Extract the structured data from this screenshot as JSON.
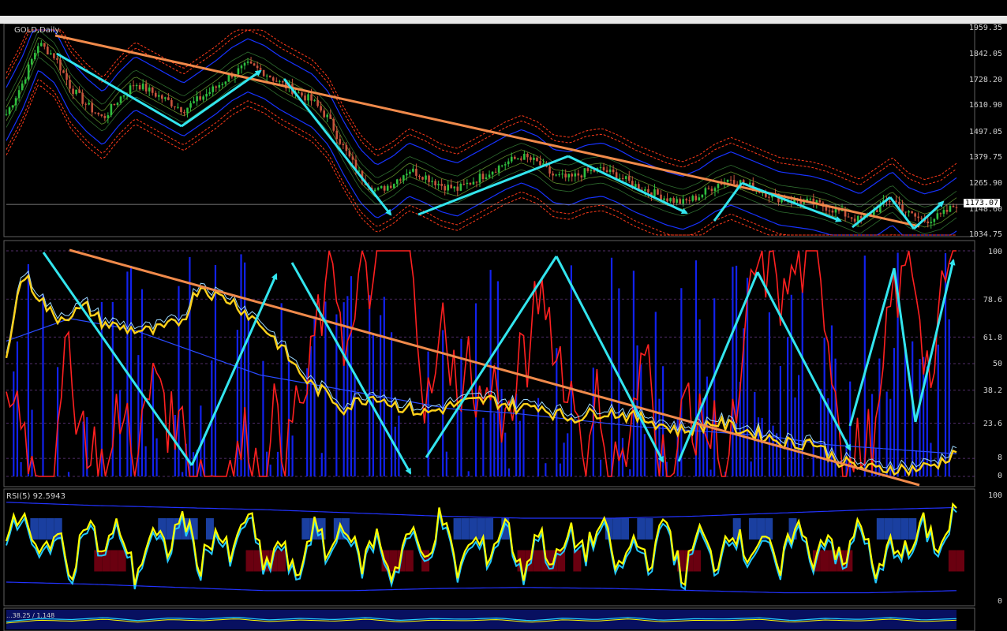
{
  "window": {
    "title": "GOLD,Daily"
  },
  "colors": {
    "background": "#000000",
    "trend_line": "#f08a4b",
    "wave_arrows": "#33e5ee",
    "price_up": "#2fbf3f",
    "price_down": "#c8553d",
    "band_blue": "#1733ff",
    "band_red": "#ff3a1a",
    "oscillator_yellow": "#ffd21a",
    "stoch_red": "#ff2020",
    "stoch_blue": "#1222ee",
    "rsi_yellow": "#ffff00",
    "rsi_cyan": "#22c8ff"
  },
  "chart_data": [
    {
      "type": "line",
      "pane": "price",
      "title": "GOLD,Daily",
      "ylim": [
        1034.75,
        1959.35
      ],
      "y_ticks": [
        "1959.35",
        "1842.05",
        "1728.20",
        "1610.90",
        "1497.05",
        "1379.75",
        "1265.90",
        "1148.60",
        "1034.75"
      ],
      "current_price": "1173.07",
      "series": [
        {
          "values": [
            1580,
            1720,
            1900,
            1840,
            1700,
            1620,
            1560,
            1650,
            1720,
            1680,
            1640,
            1600,
            1650,
            1700,
            1760,
            1800,
            1770,
            1720,
            1680,
            1640,
            1560,
            1420,
            1300,
            1230,
            1270,
            1330,
            1300,
            1260,
            1240,
            1280,
            1320,
            1360,
            1390,
            1360,
            1300,
            1290,
            1320,
            1330,
            1300,
            1260,
            1230,
            1200,
            1180,
            1210,
            1260,
            1290,
            1260,
            1230,
            1200,
            1190,
            1180,
            1160,
            1130,
            1100,
            1150,
            1200,
            1130,
            1100,
            1120,
            1173
          ]
        }
      ]
    },
    {
      "type": "line",
      "pane": "stochastic",
      "ylim": [
        0,
        100
      ],
      "y_ticks": [
        "100",
        "78.6",
        "61.8",
        "50",
        "38.2",
        "23.6",
        "8",
        "0"
      ],
      "series": [
        {
          "values": [
            55,
            90,
            80,
            70,
            72,
            75,
            68,
            66,
            65,
            64,
            66,
            70,
            85,
            80,
            78,
            72,
            66,
            58,
            48,
            40,
            36,
            30,
            34,
            36,
            32,
            30,
            28,
            30,
            32,
            33,
            34,
            32,
            30,
            32,
            28,
            26,
            27,
            29,
            28,
            26,
            25,
            22,
            20,
            22,
            24,
            22,
            20,
            18,
            16,
            14,
            16,
            10,
            6,
            4,
            3,
            4,
            3,
            4,
            6,
            12
          ]
        }
      ]
    },
    {
      "type": "line",
      "pane": "rsi",
      "title": "RSI(5) 92.5943",
      "ylim": [
        0,
        100
      ],
      "y_ticks": [
        "100",
        "0"
      ],
      "series": [
        {
          "values": [
            60,
            85,
            40,
            70,
            30,
            80,
            45,
            75,
            25,
            65,
            50,
            85,
            35,
            70,
            40,
            90,
            30,
            60,
            20,
            75,
            45,
            80,
            35,
            65,
            25,
            70,
            40,
            85,
            30,
            60,
            45,
            80,
            25,
            70,
            35,
            65,
            50,
            75,
            30,
            60,
            40,
            80,
            20,
            70,
            35,
            75,
            45,
            65,
            25,
            80,
            40,
            70,
            30,
            85,
            20,
            60,
            45,
            75,
            50,
            92.59
          ]
        }
      ]
    },
    {
      "type": "line",
      "pane": "bottom-oscillator",
      "title": "...38.25 / 1.148",
      "ylim": [
        0,
        100
      ],
      "series": [
        {
          "values": [
            40,
            55,
            50,
            60,
            45,
            58,
            52,
            62,
            48,
            56,
            50,
            60,
            46,
            55,
            52,
            58,
            44,
            57,
            50,
            61,
            47,
            54,
            53,
            59,
            45,
            56,
            51,
            60,
            48,
            55
          ]
        }
      ]
    }
  ],
  "annotations": {
    "trend_price": [
      [
        70,
        45
      ],
      [
        1165,
        287
      ]
    ],
    "trend_stoch": [
      [
        88,
        317
      ],
      [
        1165,
        615
      ]
    ],
    "waves_price": [
      [
        [
          72,
          68
        ],
        [
          230,
          160
        ],
        [
          330,
          90
        ]
      ],
      [
        [
          360,
          100
        ],
        [
          495,
          272
        ]
      ],
      [
        [
          530,
          272
        ],
        [
          720,
          198
        ],
        [
          870,
          270
        ]
      ],
      [
        [
          905,
          280
        ],
        [
          940,
          232
        ],
        [
          1065,
          280
        ]
      ],
      [
        [
          1080,
          288
        ],
        [
          1128,
          250
        ],
        [
          1158,
          290
        ],
        [
          1195,
          256
        ]
      ]
    ],
    "waves_stoch": [
      [
        [
          55,
          320
        ],
        [
          243,
          590
        ],
        [
          350,
          348
        ]
      ],
      [
        [
          370,
          333
        ],
        [
          520,
          600
        ]
      ],
      [
        [
          540,
          580
        ],
        [
          705,
          325
        ],
        [
          840,
          585
        ]
      ],
      [
        [
          860,
          585
        ],
        [
          960,
          345
        ],
        [
          1077,
          570
        ]
      ],
      [
        [
          1077,
          540
        ],
        [
          1133,
          340
        ],
        [
          1160,
          535
        ],
        [
          1208,
          330
        ]
      ]
    ]
  }
}
